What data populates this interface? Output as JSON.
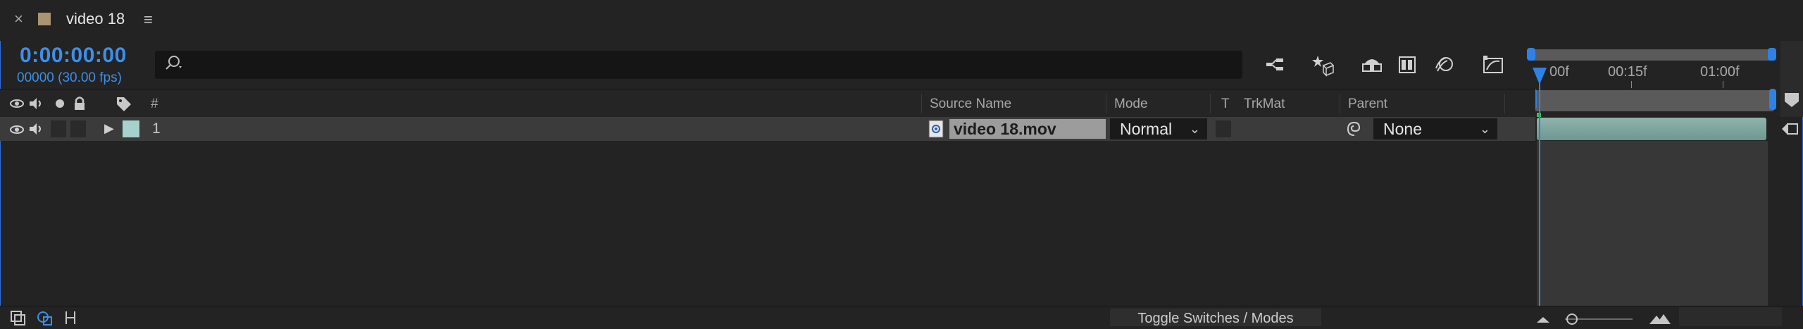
{
  "tab": {
    "close_glyph": "×",
    "title": "video 18",
    "menu_glyph": "≡",
    "swatch_color": "#a99572"
  },
  "header": {
    "timecode": "0:00:00:00",
    "frame_rate": "00000 (30.00 fps)",
    "search_placeholder": ""
  },
  "columns": {
    "number": "#",
    "source_name": "Source Name",
    "mode": "Mode",
    "t": "T",
    "trkmat": "TrkMat",
    "parent": "Parent"
  },
  "layer": {
    "index": "1",
    "source_name": "video 18.mov",
    "mode": "Normal",
    "parent": "None",
    "label_color": "#a6d1cc"
  },
  "timeline": {
    "ticks": [
      "00f",
      "00:15f",
      "01:00f"
    ],
    "accent": "#2e82e6"
  },
  "footer": {
    "toggle_label": "Toggle Switches / Modes"
  },
  "icons": {
    "close": "close-icon",
    "panel_menu": "panel-menu-icon",
    "search": "search-icon",
    "shy": "comp-flowchart-icon",
    "draft3d": "draft-3d-icon",
    "frame_blend": "frame-blending-icon",
    "motion_blur": "motion-blur-icon",
    "graph": "graph-editor-icon",
    "video": "eye-icon",
    "audio": "speaker-icon",
    "solo": "solo-icon",
    "lock": "lock-icon",
    "label": "label-tag-icon"
  }
}
